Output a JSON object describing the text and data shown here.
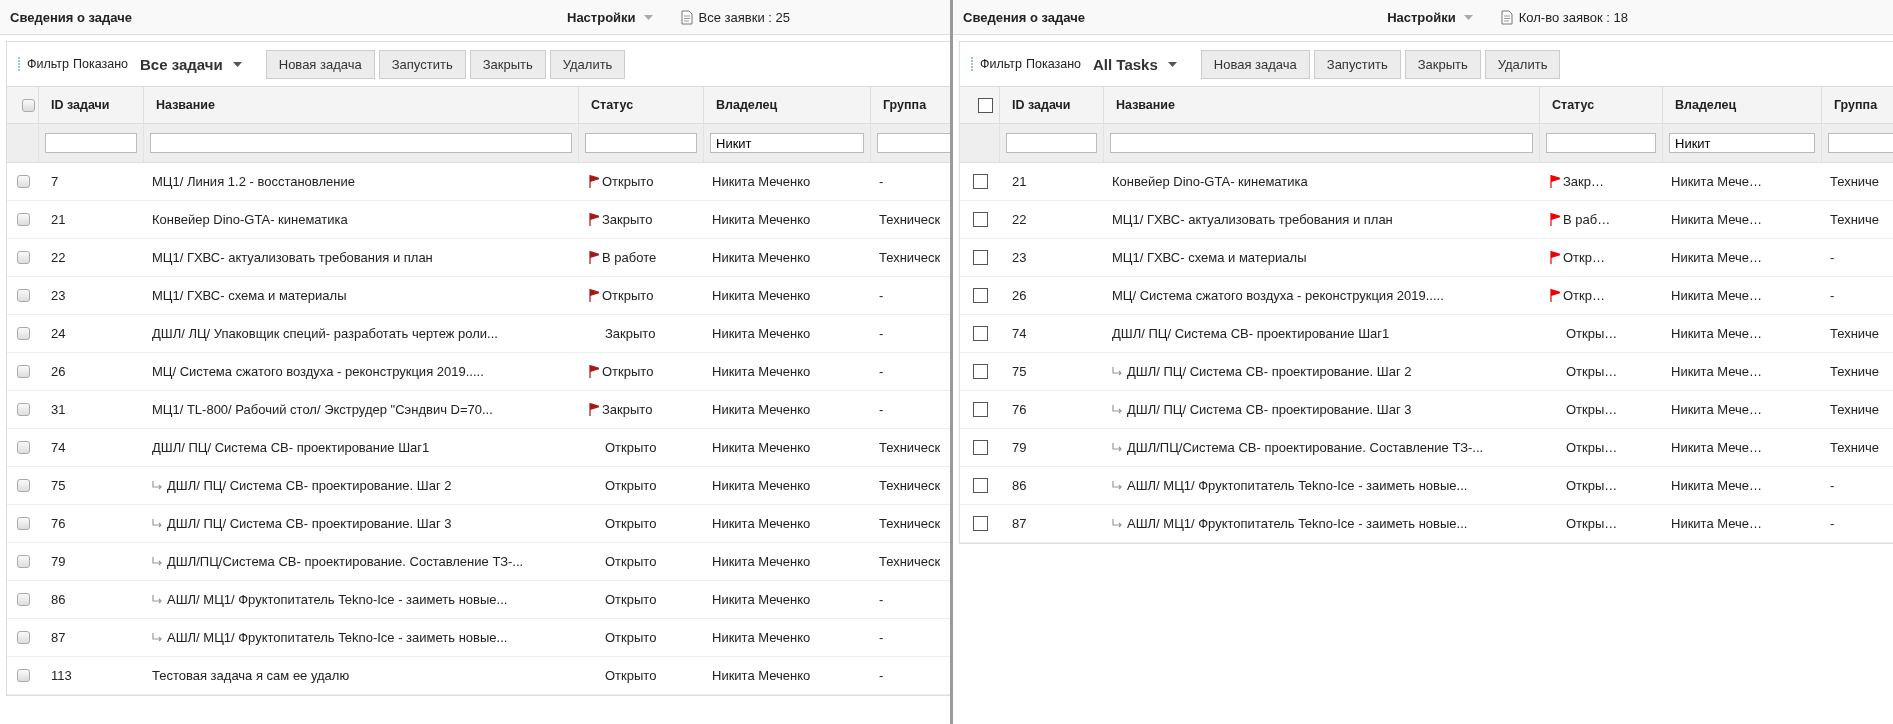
{
  "panels": [
    {
      "title": "Сведения о задаче",
      "settings": "Настройки",
      "count": "Все заявки : 25",
      "filter_label": "Фильтр",
      "shown_label": "Показано",
      "view": "Все задачи",
      "buttons": [
        "Новая задача",
        "Запустить",
        "Закрыть",
        "Удалить"
      ],
      "select_all_checked": false,
      "columns": [
        {
          "label": "ID задачи"
        },
        {
          "label": "Название"
        },
        {
          "label": "Статус"
        },
        {
          "label": "Владелец",
          "filter": "Никит"
        },
        {
          "label": "Группа"
        }
      ],
      "rows": [
        {
          "checked": false,
          "id": "7",
          "name": "МЦ1/ Линия 1.2 - восстановление",
          "child": false,
          "flagged": true,
          "status": "Открыто",
          "owner": "Никита Меченко",
          "group": "-"
        },
        {
          "checked": false,
          "id": "21",
          "name": "Конвейер Dino-GTA- кинематика",
          "child": false,
          "flagged": true,
          "status": "Закрыто",
          "owner": "Никита Меченко",
          "group": "Техническ"
        },
        {
          "checked": false,
          "id": "22",
          "name": "МЦ1/ ГХВС- актуализовать требования и план",
          "child": false,
          "flagged": true,
          "status": "В работе",
          "owner": "Никита Меченко",
          "group": "Техническ"
        },
        {
          "checked": false,
          "id": "23",
          "name": "МЦ1/ ГХВС- схема и материалы",
          "child": false,
          "flagged": true,
          "status": "Открыто",
          "owner": "Никита Меченко",
          "group": "-"
        },
        {
          "checked": false,
          "id": "24",
          "name": "ДШЛ/ ЛЦ/ Упаковщик специй- разработать чертеж роли...",
          "child": false,
          "flagged": false,
          "status": "Закрыто",
          "owner": "Никита Меченко",
          "group": "-"
        },
        {
          "checked": false,
          "id": "26",
          "name": "МЦ/ Система сжатого воздуха - реконструкция 2019.....",
          "child": false,
          "flagged": true,
          "status": "Открыто",
          "owner": "Никита Меченко",
          "group": "-"
        },
        {
          "checked": false,
          "id": "31",
          "name": "МЦ1/ TL-800/ Рабочий стол/ Экструдер \"Сэндвич D=70...",
          "child": false,
          "flagged": true,
          "status": "Закрыто",
          "owner": "Никита Меченко",
          "group": "-"
        },
        {
          "checked": false,
          "id": "74",
          "name": "ДШЛ/ ПЦ/ Система СВ- проектирование Шаг1",
          "child": false,
          "flagged": false,
          "status": "Открыто",
          "owner": "Никита Меченко",
          "group": "Техническ"
        },
        {
          "checked": false,
          "id": "75",
          "name": "ДШЛ/ ПЦ/ Система СВ- проектирование. Шаг 2",
          "child": true,
          "flagged": false,
          "status": "Открыто",
          "owner": "Никита Меченко",
          "group": "Техническ"
        },
        {
          "checked": false,
          "id": "76",
          "name": "ДШЛ/ ПЦ/ Система СВ- проектирование. Шаг 3",
          "child": true,
          "flagged": false,
          "status": "Открыто",
          "owner": "Никита Меченко",
          "group": "Техническ"
        },
        {
          "checked": false,
          "id": "79",
          "name": "ДШЛ/ПЦ/Система СВ- проектирование. Составление ТЗ-...",
          "child": true,
          "flagged": false,
          "status": "Открыто",
          "owner": "Никита Меченко",
          "group": "Техническ"
        },
        {
          "checked": false,
          "id": "86",
          "name": "АШЛ/ МЦ1/ Фруктопитатель Tekno-Ice - заиметь новые...",
          "child": true,
          "flagged": false,
          "status": "Открыто",
          "owner": "Никита Меченко",
          "group": "-"
        },
        {
          "checked": false,
          "id": "87",
          "name": "АШЛ/ МЦ1/ Фруктопитатель Tekno-Ice - заиметь новые...",
          "child": true,
          "flagged": false,
          "status": "Открыто",
          "owner": "Никита Меченко",
          "group": "-"
        },
        {
          "checked": false,
          "id": "113",
          "name": "Тестовая задача я сам ее удалю",
          "child": false,
          "flagged": false,
          "status": "Открыто",
          "owner": "Никита Меченко",
          "group": "-"
        }
      ]
    },
    {
      "title": "Сведения о задаче",
      "settings": "Настройки",
      "count": "Кол-во заявок : 18",
      "filter_label": "Фильтр",
      "shown_label": "Показано",
      "view": "All Tasks",
      "buttons": [
        "Новая задача",
        "Запустить",
        "Закрыть",
        "Удалить"
      ],
      "select_all_checked": false,
      "columns": [
        {
          "label": "ID задачи"
        },
        {
          "label": "Название"
        },
        {
          "label": "Статус"
        },
        {
          "label": "Владелец",
          "filter": "Никит"
        },
        {
          "label": "Группа"
        }
      ],
      "rows": [
        {
          "checked": false,
          "id": "21",
          "name": "Конвейер Dino-GTA- кинематика",
          "child": false,
          "flagged": true,
          "status": "Закр…",
          "owner": "Никита Мече…",
          "group": "Техниче"
        },
        {
          "checked": false,
          "id": "22",
          "name": "МЦ1/ ГХВС- актуализовать требования и план",
          "child": false,
          "flagged": true,
          "status": "В раб…",
          "owner": "Никита Мече…",
          "group": "Техниче"
        },
        {
          "checked": false,
          "id": "23",
          "name": "МЦ1/ ГХВС- схема и материалы",
          "child": false,
          "flagged": true,
          "status": "Откр…",
          "owner": "Никита Мече…",
          "group": "-"
        },
        {
          "checked": false,
          "id": "26",
          "name": "МЦ/ Система сжатого воздуха - реконструкция 2019.....",
          "child": false,
          "flagged": true,
          "status": "Откр…",
          "owner": "Никита Мече…",
          "group": "-"
        },
        {
          "checked": false,
          "id": "74",
          "name": "ДШЛ/ ПЦ/ Система СВ- проектирование Шаг1",
          "child": false,
          "flagged": false,
          "status": "Откры…",
          "owner": "Никита Мече…",
          "group": "Техниче"
        },
        {
          "checked": false,
          "id": "75",
          "name": "ДШЛ/ ПЦ/ Система СВ- проектирование. Шаг 2",
          "child": true,
          "flagged": false,
          "status": "Откры…",
          "owner": "Никита Мече…",
          "group": "Техниче"
        },
        {
          "checked": false,
          "id": "76",
          "name": "ДШЛ/ ПЦ/ Система СВ- проектирование. Шаг 3",
          "child": true,
          "flagged": false,
          "status": "Откры…",
          "owner": "Никита Мече…",
          "group": "Техниче"
        },
        {
          "checked": false,
          "id": "79",
          "name": "ДШЛ/ПЦ/Система СВ- проектирование. Составление ТЗ-...",
          "child": true,
          "flagged": false,
          "status": "Откры…",
          "owner": "Никита Мече…",
          "group": "Техниче"
        },
        {
          "checked": false,
          "id": "86",
          "name": "АШЛ/ МЦ1/ Фруктопитатель Tekno-Ice - заиметь новые...",
          "child": true,
          "flagged": false,
          "status": "Откры…",
          "owner": "Никита Мече…",
          "group": "-"
        },
        {
          "checked": false,
          "id": "87",
          "name": "АШЛ/ МЦ1/ Фруктопитатель Tekno-Ice - заиметь новые...",
          "child": true,
          "flagged": false,
          "status": "Откры…",
          "owner": "Никита Мече…",
          "group": "-"
        }
      ]
    }
  ]
}
